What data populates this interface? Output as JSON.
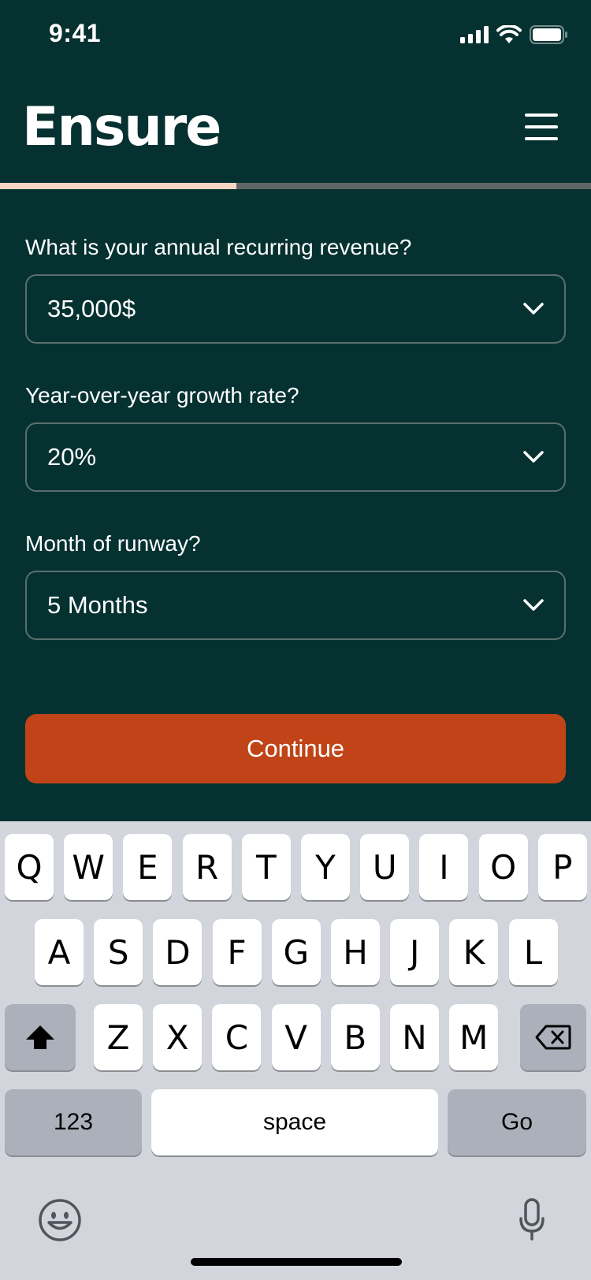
{
  "status_bar": {
    "time": "9:41"
  },
  "header": {
    "logo": "Ensure"
  },
  "progress": {
    "fraction": 0.4
  },
  "form": {
    "fields": [
      {
        "label": "What is your annual recurring revenue?",
        "value": "35,000$"
      },
      {
        "label": "Year-over-year growth rate?",
        "value": "20%"
      },
      {
        "label": "Month of runway?",
        "value": "5 Months"
      }
    ],
    "continue_label": "Continue"
  },
  "keyboard": {
    "row1": [
      "Q",
      "W",
      "E",
      "R",
      "T",
      "Y",
      "U",
      "I",
      "O",
      "P"
    ],
    "row2": [
      "A",
      "S",
      "D",
      "F",
      "G",
      "H",
      "J",
      "K",
      "L"
    ],
    "row3": [
      "Z",
      "X",
      "C",
      "V",
      "B",
      "N",
      "M"
    ],
    "numbers_label": "123",
    "space_label": "space",
    "go_label": "Go"
  },
  "colors": {
    "background": "#063131",
    "accent": "#c04417",
    "progress_fill": "#f7d4c3"
  },
  "icons": [
    "signal-icon",
    "wifi-icon",
    "battery-icon",
    "menu-icon",
    "chevron-down-icon",
    "shift-icon",
    "backspace-icon",
    "emoji-icon",
    "microphone-icon"
  ]
}
